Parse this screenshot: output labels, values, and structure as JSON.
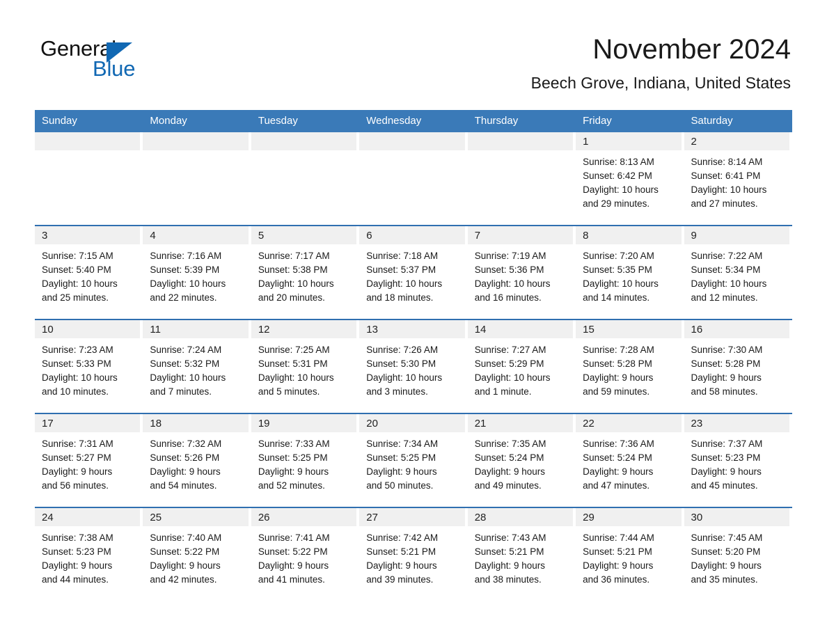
{
  "brand": {
    "name_part1": "General",
    "name_part2": "Blue",
    "accent_color": "#1168b3"
  },
  "header": {
    "month_title": "November 2024",
    "location": "Beech Grove, Indiana, United States"
  },
  "calendar": {
    "header_bg": "#3a7ab8",
    "week_separator_color": "#2f6fb0",
    "daynum_strip_bg": "#f0f0f0",
    "weekday_headers": [
      "Sunday",
      "Monday",
      "Tuesday",
      "Wednesday",
      "Thursday",
      "Friday",
      "Saturday"
    ],
    "weeks": [
      [
        {
          "day": "",
          "sunrise": "",
          "sunset": "",
          "daylight_line1": "",
          "daylight_line2": ""
        },
        {
          "day": "",
          "sunrise": "",
          "sunset": "",
          "daylight_line1": "",
          "daylight_line2": ""
        },
        {
          "day": "",
          "sunrise": "",
          "sunset": "",
          "daylight_line1": "",
          "daylight_line2": ""
        },
        {
          "day": "",
          "sunrise": "",
          "sunset": "",
          "daylight_line1": "",
          "daylight_line2": ""
        },
        {
          "day": "",
          "sunrise": "",
          "sunset": "",
          "daylight_line1": "",
          "daylight_line2": ""
        },
        {
          "day": "1",
          "sunrise": "Sunrise: 8:13 AM",
          "sunset": "Sunset: 6:42 PM",
          "daylight_line1": "Daylight: 10 hours",
          "daylight_line2": "and 29 minutes."
        },
        {
          "day": "2",
          "sunrise": "Sunrise: 8:14 AM",
          "sunset": "Sunset: 6:41 PM",
          "daylight_line1": "Daylight: 10 hours",
          "daylight_line2": "and 27 minutes."
        }
      ],
      [
        {
          "day": "3",
          "sunrise": "Sunrise: 7:15 AM",
          "sunset": "Sunset: 5:40 PM",
          "daylight_line1": "Daylight: 10 hours",
          "daylight_line2": "and 25 minutes."
        },
        {
          "day": "4",
          "sunrise": "Sunrise: 7:16 AM",
          "sunset": "Sunset: 5:39 PM",
          "daylight_line1": "Daylight: 10 hours",
          "daylight_line2": "and 22 minutes."
        },
        {
          "day": "5",
          "sunrise": "Sunrise: 7:17 AM",
          "sunset": "Sunset: 5:38 PM",
          "daylight_line1": "Daylight: 10 hours",
          "daylight_line2": "and 20 minutes."
        },
        {
          "day": "6",
          "sunrise": "Sunrise: 7:18 AM",
          "sunset": "Sunset: 5:37 PM",
          "daylight_line1": "Daylight: 10 hours",
          "daylight_line2": "and 18 minutes."
        },
        {
          "day": "7",
          "sunrise": "Sunrise: 7:19 AM",
          "sunset": "Sunset: 5:36 PM",
          "daylight_line1": "Daylight: 10 hours",
          "daylight_line2": "and 16 minutes."
        },
        {
          "day": "8",
          "sunrise": "Sunrise: 7:20 AM",
          "sunset": "Sunset: 5:35 PM",
          "daylight_line1": "Daylight: 10 hours",
          "daylight_line2": "and 14 minutes."
        },
        {
          "day": "9",
          "sunrise": "Sunrise: 7:22 AM",
          "sunset": "Sunset: 5:34 PM",
          "daylight_line1": "Daylight: 10 hours",
          "daylight_line2": "and 12 minutes."
        }
      ],
      [
        {
          "day": "10",
          "sunrise": "Sunrise: 7:23 AM",
          "sunset": "Sunset: 5:33 PM",
          "daylight_line1": "Daylight: 10 hours",
          "daylight_line2": "and 10 minutes."
        },
        {
          "day": "11",
          "sunrise": "Sunrise: 7:24 AM",
          "sunset": "Sunset: 5:32 PM",
          "daylight_line1": "Daylight: 10 hours",
          "daylight_line2": "and 7 minutes."
        },
        {
          "day": "12",
          "sunrise": "Sunrise: 7:25 AM",
          "sunset": "Sunset: 5:31 PM",
          "daylight_line1": "Daylight: 10 hours",
          "daylight_line2": "and 5 minutes."
        },
        {
          "day": "13",
          "sunrise": "Sunrise: 7:26 AM",
          "sunset": "Sunset: 5:30 PM",
          "daylight_line1": "Daylight: 10 hours",
          "daylight_line2": "and 3 minutes."
        },
        {
          "day": "14",
          "sunrise": "Sunrise: 7:27 AM",
          "sunset": "Sunset: 5:29 PM",
          "daylight_line1": "Daylight: 10 hours",
          "daylight_line2": "and 1 minute."
        },
        {
          "day": "15",
          "sunrise": "Sunrise: 7:28 AM",
          "sunset": "Sunset: 5:28 PM",
          "daylight_line1": "Daylight: 9 hours",
          "daylight_line2": "and 59 minutes."
        },
        {
          "day": "16",
          "sunrise": "Sunrise: 7:30 AM",
          "sunset": "Sunset: 5:28 PM",
          "daylight_line1": "Daylight: 9 hours",
          "daylight_line2": "and 58 minutes."
        }
      ],
      [
        {
          "day": "17",
          "sunrise": "Sunrise: 7:31 AM",
          "sunset": "Sunset: 5:27 PM",
          "daylight_line1": "Daylight: 9 hours",
          "daylight_line2": "and 56 minutes."
        },
        {
          "day": "18",
          "sunrise": "Sunrise: 7:32 AM",
          "sunset": "Sunset: 5:26 PM",
          "daylight_line1": "Daylight: 9 hours",
          "daylight_line2": "and 54 minutes."
        },
        {
          "day": "19",
          "sunrise": "Sunrise: 7:33 AM",
          "sunset": "Sunset: 5:25 PM",
          "daylight_line1": "Daylight: 9 hours",
          "daylight_line2": "and 52 minutes."
        },
        {
          "day": "20",
          "sunrise": "Sunrise: 7:34 AM",
          "sunset": "Sunset: 5:25 PM",
          "daylight_line1": "Daylight: 9 hours",
          "daylight_line2": "and 50 minutes."
        },
        {
          "day": "21",
          "sunrise": "Sunrise: 7:35 AM",
          "sunset": "Sunset: 5:24 PM",
          "daylight_line1": "Daylight: 9 hours",
          "daylight_line2": "and 49 minutes."
        },
        {
          "day": "22",
          "sunrise": "Sunrise: 7:36 AM",
          "sunset": "Sunset: 5:24 PM",
          "daylight_line1": "Daylight: 9 hours",
          "daylight_line2": "and 47 minutes."
        },
        {
          "day": "23",
          "sunrise": "Sunrise: 7:37 AM",
          "sunset": "Sunset: 5:23 PM",
          "daylight_line1": "Daylight: 9 hours",
          "daylight_line2": "and 45 minutes."
        }
      ],
      [
        {
          "day": "24",
          "sunrise": "Sunrise: 7:38 AM",
          "sunset": "Sunset: 5:23 PM",
          "daylight_line1": "Daylight: 9 hours",
          "daylight_line2": "and 44 minutes."
        },
        {
          "day": "25",
          "sunrise": "Sunrise: 7:40 AM",
          "sunset": "Sunset: 5:22 PM",
          "daylight_line1": "Daylight: 9 hours",
          "daylight_line2": "and 42 minutes."
        },
        {
          "day": "26",
          "sunrise": "Sunrise: 7:41 AM",
          "sunset": "Sunset: 5:22 PM",
          "daylight_line1": "Daylight: 9 hours",
          "daylight_line2": "and 41 minutes."
        },
        {
          "day": "27",
          "sunrise": "Sunrise: 7:42 AM",
          "sunset": "Sunset: 5:21 PM",
          "daylight_line1": "Daylight: 9 hours",
          "daylight_line2": "and 39 minutes."
        },
        {
          "day": "28",
          "sunrise": "Sunrise: 7:43 AM",
          "sunset": "Sunset: 5:21 PM",
          "daylight_line1": "Daylight: 9 hours",
          "daylight_line2": "and 38 minutes."
        },
        {
          "day": "29",
          "sunrise": "Sunrise: 7:44 AM",
          "sunset": "Sunset: 5:21 PM",
          "daylight_line1": "Daylight: 9 hours",
          "daylight_line2": "and 36 minutes."
        },
        {
          "day": "30",
          "sunrise": "Sunrise: 7:45 AM",
          "sunset": "Sunset: 5:20 PM",
          "daylight_line1": "Daylight: 9 hours",
          "daylight_line2": "and 35 minutes."
        }
      ]
    ]
  }
}
